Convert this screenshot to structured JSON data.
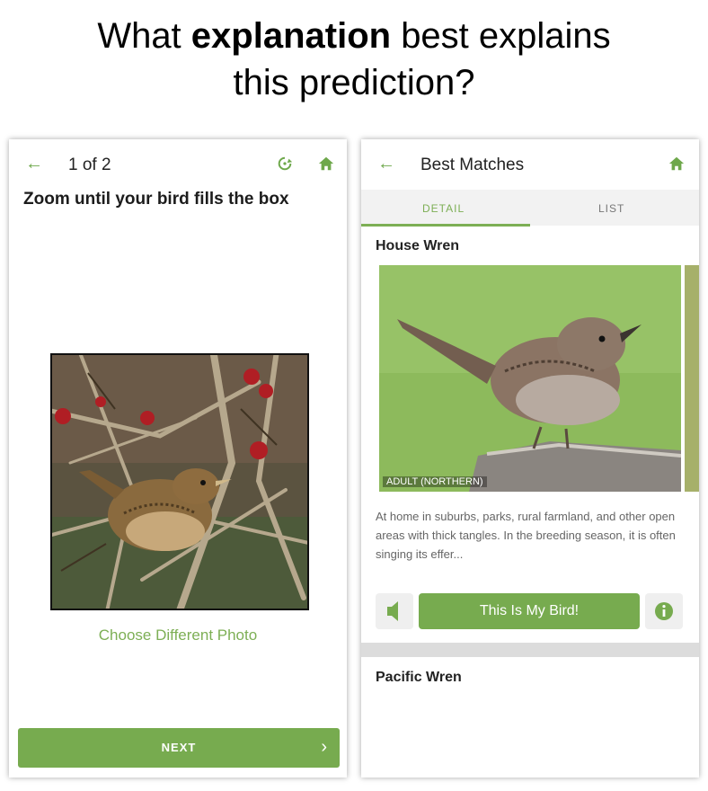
{
  "headline": {
    "prefix": "What",
    "bold": "explanation",
    "suffix": "best explains",
    "line2": "this prediction?"
  },
  "left_screen": {
    "header": {
      "back_icon": "arrow-left-icon",
      "counter": "1 of 2",
      "icons": [
        "rotate-icon",
        "home-icon"
      ]
    },
    "instruction": "Zoom until your bird fills the box",
    "choose_photo": "Choose Different Photo",
    "next_label": "NEXT",
    "next_icon": "chevron-right-icon"
  },
  "right_screen": {
    "header": {
      "back_icon": "arrow-left-icon",
      "title": "Best Matches",
      "icons": [
        "home-icon"
      ]
    },
    "tabs": [
      {
        "label": "DETAIL",
        "active": true
      },
      {
        "label": "LIST",
        "active": false
      }
    ],
    "match1": {
      "name": "House Wren",
      "photo_caption": "ADULT (NORTHERN)",
      "description": "At home in suburbs, parks, rural farmland, and other open areas with thick tangles. In the breeding season, it is often singing its effer...",
      "confirm_label": "This Is My Bird!",
      "sound_icon": "speaker-icon",
      "info_icon": "info-icon"
    },
    "match2": {
      "name": "Pacific Wren"
    }
  },
  "colors": {
    "accent": "#77ab4f",
    "accent_text": "#7daf55"
  }
}
